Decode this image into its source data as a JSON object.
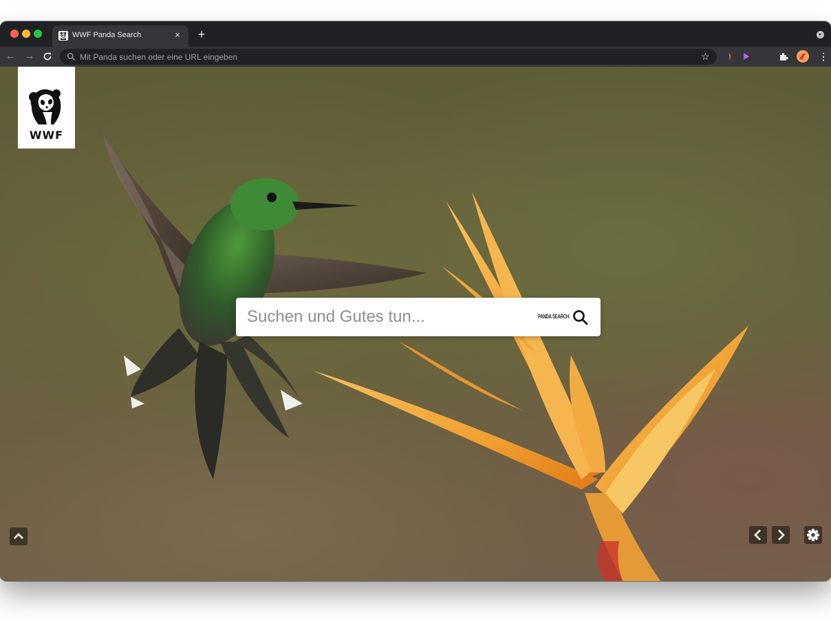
{
  "browser": {
    "tab": {
      "title": "WWF Panda Search",
      "close_glyph": "×"
    },
    "new_tab_glyph": "+",
    "nav": {
      "back_glyph": "←",
      "forward_glyph": "→",
      "reload_glyph": "C"
    },
    "omnibox": {
      "placeholder": "Mit Panda suchen oder eine URL eingeben"
    },
    "star_glyph": "☆",
    "menu_glyph": "⋮"
  },
  "page": {
    "logo_text": "WWF",
    "search": {
      "placeholder": "Suchen und Gutes tun...",
      "brand_label": "PANDA SEARCH"
    },
    "icons": {
      "search": "search-icon",
      "scroll_up": "chevron-up-icon",
      "prev": "chevron-left-icon",
      "next": "chevron-right-icon",
      "settings": "gear-icon"
    }
  }
}
